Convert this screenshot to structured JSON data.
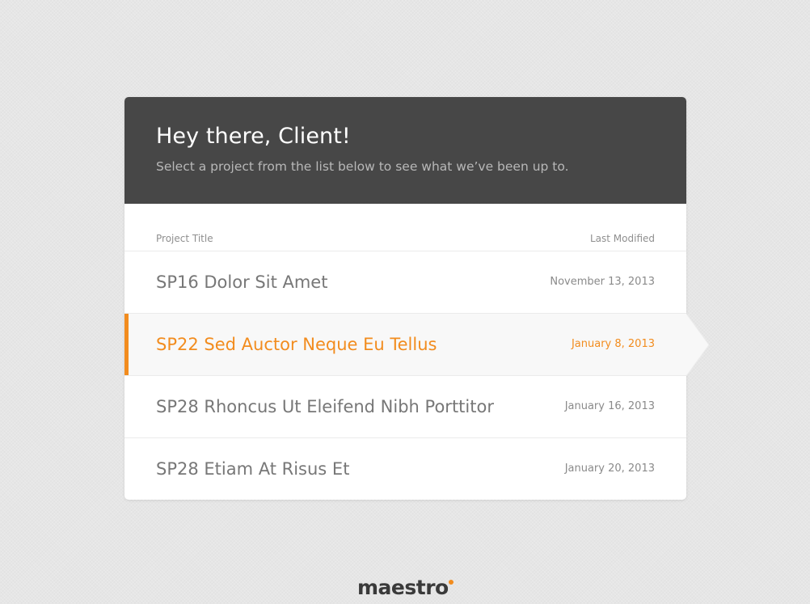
{
  "header": {
    "greeting": "Hey there, Client!",
    "subtitle": "Select a project from the list below to see what we’ve been up to."
  },
  "columns": {
    "title": "Project Title",
    "date": "Last Modified"
  },
  "projects": [
    {
      "title": "SP16 Dolor Sit Amet",
      "date": "November 13, 2013",
      "selected": false
    },
    {
      "title": "SP22 Sed Auctor Neque Eu Tellus",
      "date": "January 8, 2013",
      "selected": true
    },
    {
      "title": "SP28 Rhoncus Ut Eleifend Nibh Porttitor",
      "date": "January 16, 2013",
      "selected": false
    },
    {
      "title": "SP28 Etiam At Risus Et",
      "date": "January 20, 2013",
      "selected": false
    }
  ],
  "footer": {
    "logo": "maestro"
  },
  "colors": {
    "accent": "#f28c1e",
    "header_bg": "#474747",
    "page_bg": "#e6e6e6"
  }
}
